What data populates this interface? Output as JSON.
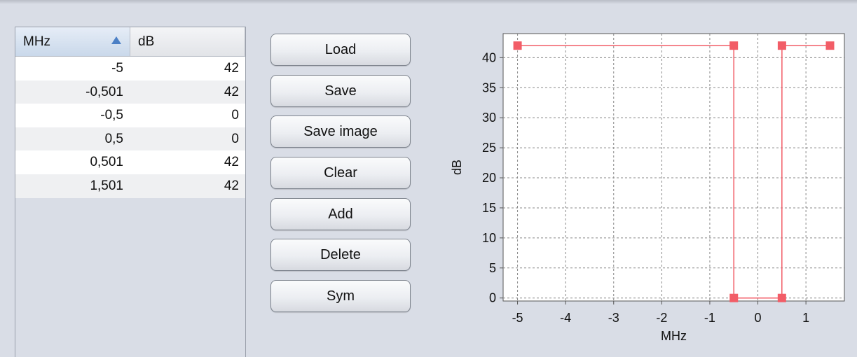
{
  "table": {
    "headers": {
      "mhz": "MHz",
      "db": "dB"
    },
    "rows": [
      {
        "mhz": "-5",
        "db": "42"
      },
      {
        "mhz": "-0,501",
        "db": "42"
      },
      {
        "mhz": "-0,5",
        "db": "0"
      },
      {
        "mhz": "0,5",
        "db": "0"
      },
      {
        "mhz": "0,501",
        "db": "42"
      },
      {
        "mhz": "1,501",
        "db": "42"
      }
    ]
  },
  "buttons": {
    "load": "Load",
    "save": "Save",
    "save_image": "Save image",
    "clear": "Clear",
    "add": "Add",
    "delete": "Delete",
    "sym": "Sym"
  },
  "chart_data": {
    "type": "line",
    "xlabel": "MHz",
    "ylabel": "dB",
    "x": [
      -5,
      -0.501,
      -0.5,
      0.5,
      0.501,
      1.501
    ],
    "series": [
      {
        "values": [
          42,
          42,
          0,
          0,
          42,
          42
        ]
      }
    ],
    "xticks": [
      -5,
      -4,
      -3,
      -2,
      -1,
      0,
      1
    ],
    "yticks": [
      0,
      5,
      10,
      15,
      20,
      25,
      30,
      35,
      40
    ],
    "xlim": [
      -5.3,
      1.8
    ],
    "ylim": [
      -0.5,
      44
    ],
    "grid": true,
    "color": "#f25d67"
  }
}
